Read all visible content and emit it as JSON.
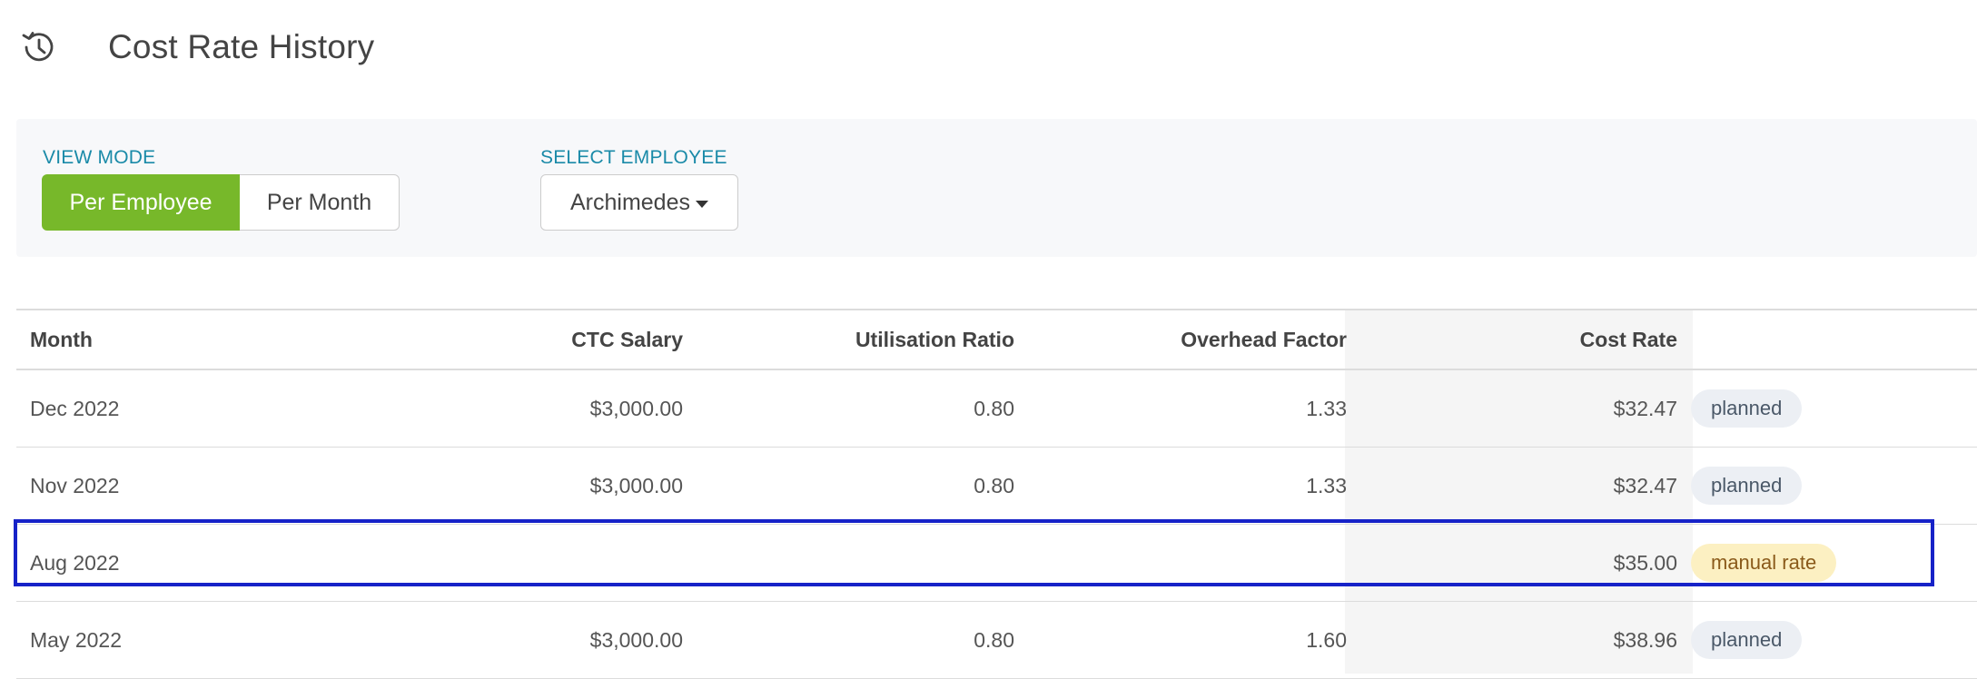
{
  "header": {
    "title": "Cost Rate History",
    "icon": "history-icon"
  },
  "filters": {
    "view_mode_label": "VIEW MODE",
    "view_mode_options": [
      "Per Employee",
      "Per Month"
    ],
    "view_mode_selected": "Per Employee",
    "employee_label": "SELECT EMPLOYEE",
    "employee_value": "Archimedes"
  },
  "table": {
    "columns": [
      "Month",
      "CTC Salary",
      "Utilisation Ratio",
      "Overhead Factor",
      "Cost Rate",
      ""
    ],
    "rows": [
      {
        "month": "Dec 2022",
        "ctc": "$3,000.00",
        "util": "0.80",
        "overhead": "1.33",
        "cost": "$32.47",
        "status": "planned"
      },
      {
        "month": "Nov 2022",
        "ctc": "$3,000.00",
        "util": "0.80",
        "overhead": "1.33",
        "cost": "$32.47",
        "status": "planned"
      },
      {
        "month": "Aug 2022",
        "ctc": "",
        "util": "",
        "overhead": "",
        "cost": "$35.00",
        "status": "manual rate"
      },
      {
        "month": "May 2022",
        "ctc": "$3,000.00",
        "util": "0.80",
        "overhead": "1.60",
        "cost": "$38.96",
        "status": "planned"
      }
    ],
    "selected_row": 2
  },
  "colors": {
    "accent_green": "#77b82a",
    "label_teal": "#1a8aa8",
    "selection_blue": "#1622c8"
  }
}
